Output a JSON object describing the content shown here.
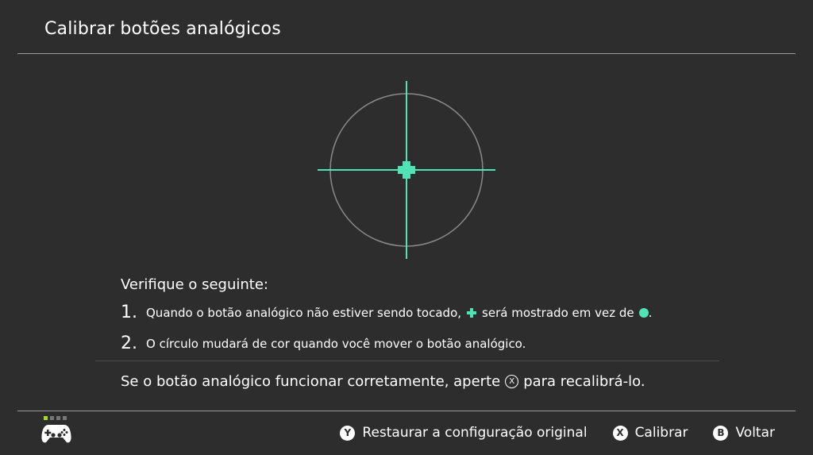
{
  "header": {
    "title": "Calibrar botões analógicos"
  },
  "colors": {
    "background": "#2d2d2d",
    "accent": "#4fe3b5",
    "ring": "#8a8a8a",
    "player_indicator": "#a6d827"
  },
  "checklist": {
    "heading": "Verifique o seguinte:",
    "steps": [
      {
        "number": "1.",
        "text_before": "Quando o botão analógico não estiver sendo tocado,",
        "text_middle": "será mostrado em vez de",
        "text_after": "."
      },
      {
        "number": "2.",
        "text": "O círculo mudará de cor quando você mover o botão analógico."
      }
    ]
  },
  "confirm": {
    "text_before": "Se o botão analógico funcionar corretamente, aperte",
    "button_glyph": "X",
    "text_after": "para recalibrá-lo."
  },
  "footer": {
    "controller_icon": "pro-controller-icon",
    "actions": [
      {
        "glyph": "Y",
        "label": "Restaurar a configuração original"
      },
      {
        "glyph": "X",
        "label": "Calibrar"
      },
      {
        "glyph": "B",
        "label": "Voltar"
      }
    ]
  }
}
